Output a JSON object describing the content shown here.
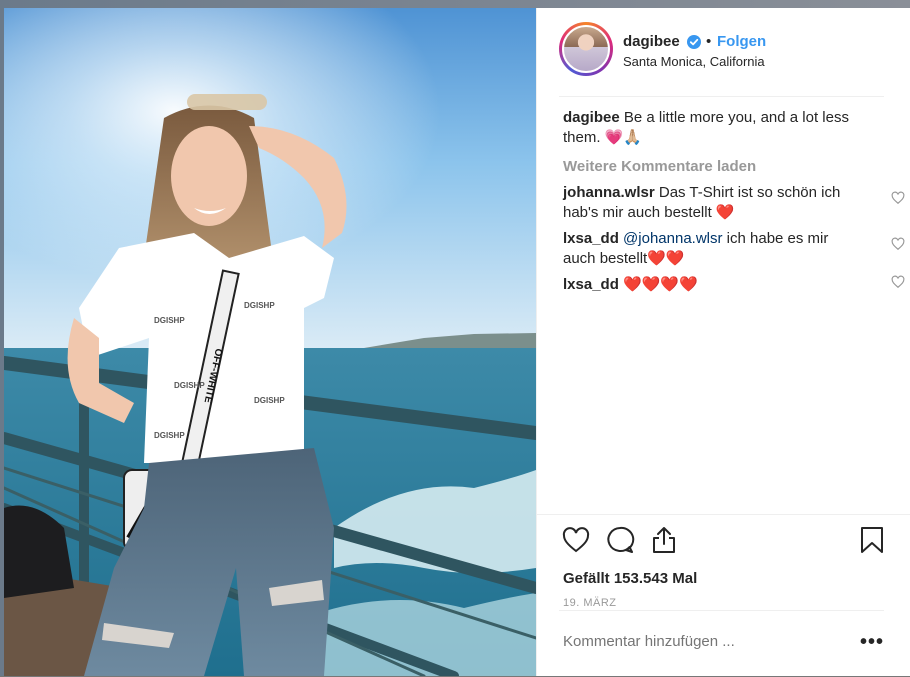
{
  "post": {
    "username": "dagibee",
    "separator": "•",
    "follow_label": "Folgen",
    "location": "Santa Monica, California",
    "caption": {
      "user": "dagibee",
      "text": "Be a little more you, and a lot less them. 💗🙏🏼"
    },
    "load_more_label": "Weitere Kommentare laden",
    "comments": [
      {
        "user": "johanna.wlsr",
        "text": "Das T-Shirt ist so schön ich hab's mir auch bestellt ❤️"
      },
      {
        "user": "lxsa_dd",
        "mention": "@johanna.wlsr",
        "text": "ich habe es mir auch bestellt❤️❤️"
      },
      {
        "user": "lxsa_dd",
        "text": "❤️❤️❤️❤️"
      }
    ],
    "likes_text": "Gefällt 153.543 Mal",
    "date": "19. MÄRZ",
    "comment_placeholder": "Kommentar hinzufügen ...",
    "more_label": "•••",
    "photo_shirt_brand": "DGISHP",
    "photo_strap_text": "OFF-WHITE"
  },
  "icons": {
    "verified": "verified-badge-icon",
    "like": "heart-icon",
    "comment": "comment-bubble-icon",
    "share": "share-icon",
    "save": "bookmark-icon"
  },
  "colors": {
    "link": "#3897f0",
    "text": "#262626",
    "muted": "#999999",
    "heart": "#ed4956"
  }
}
